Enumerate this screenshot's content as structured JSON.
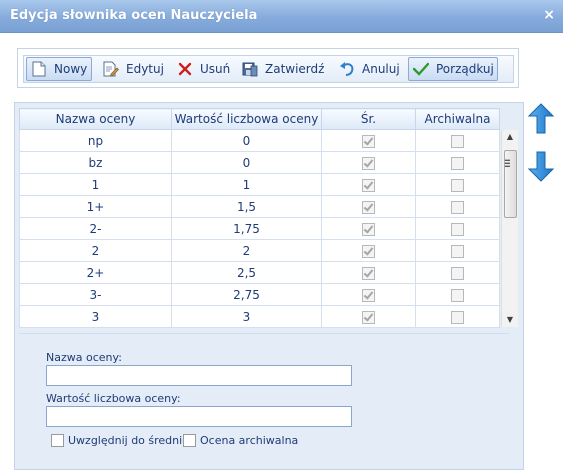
{
  "window": {
    "title": "Edycja słownika ocen Nauczyciela",
    "close_label": "×"
  },
  "toolbar": {
    "new_label": "Nowy",
    "edit_label": "Edytuj",
    "delete_label": "Usuń",
    "confirm_label": "Zatwierdź",
    "cancel_label": "Anuluj",
    "sort_label": "Porządkuj"
  },
  "grid": {
    "columns": [
      "Nazwa oceny",
      "Wartość liczbowa oceny",
      "Śr.",
      "Archiwalna"
    ],
    "rows": [
      {
        "name": "np",
        "value": "0",
        "avg": true,
        "archived": false
      },
      {
        "name": "bz",
        "value": "0",
        "avg": true,
        "archived": false
      },
      {
        "name": "1",
        "value": "1",
        "avg": true,
        "archived": false
      },
      {
        "name": "1+",
        "value": "1,5",
        "avg": true,
        "archived": false
      },
      {
        "name": "2-",
        "value": "1,75",
        "avg": true,
        "archived": false
      },
      {
        "name": "2",
        "value": "2",
        "avg": true,
        "archived": false
      },
      {
        "name": "2+",
        "value": "2,5",
        "avg": true,
        "archived": false
      },
      {
        "name": "3-",
        "value": "2,75",
        "avg": true,
        "archived": false
      },
      {
        "name": "3",
        "value": "3",
        "avg": true,
        "archived": false
      }
    ]
  },
  "form": {
    "name_label": "Nazwa oceny:",
    "name_value": "",
    "value_label": "Wartość liczbowa oceny:",
    "value_value": "",
    "include_avg_label": "Uwzględnij do średniej",
    "include_avg_checked": false,
    "archived_label": "Ocena archiwalna",
    "archived_checked": false
  },
  "colors": {
    "title_bar": "#86abdc",
    "accent": "#1e3c78",
    "arrow_blue": "#2b88d8"
  }
}
